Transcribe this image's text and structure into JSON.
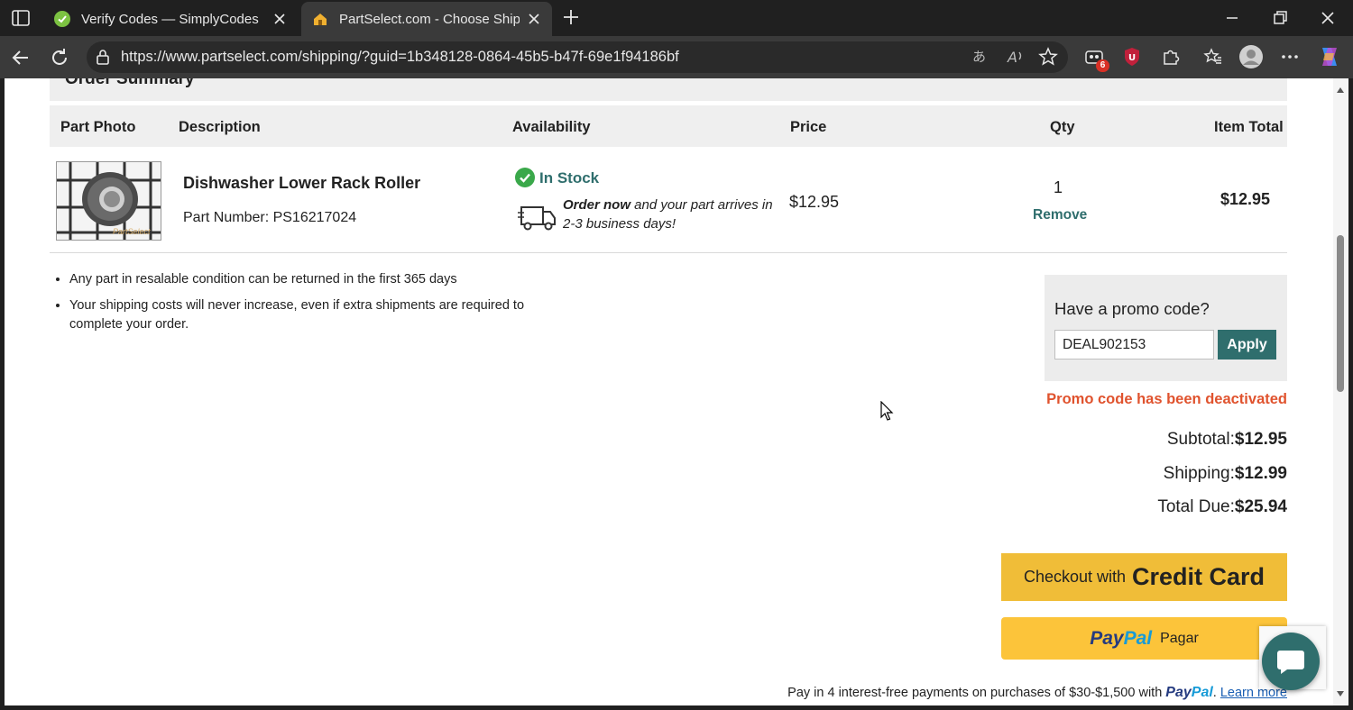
{
  "browser": {
    "tabs": [
      {
        "title": "Verify Codes — SimplyCodes",
        "active": false
      },
      {
        "title": "PartSelect.com - Choose Shipping",
        "active": true
      }
    ],
    "url": "https://www.partselect.com/shipping/?guid=1b348128-0864-45b5-b47f-69e1f94186bf",
    "extension_badge": "6"
  },
  "page": {
    "section_title": "Order Summary",
    "columns": [
      "Part Photo",
      "Description",
      "Availability",
      "Price",
      "Qty",
      "Item Total"
    ],
    "item": {
      "name": "Dishwasher Lower Rack Roller",
      "part_number": "Part Number: PS16217024",
      "availability": "In Stock",
      "ship_lead": "Order now",
      "ship_rest": " and your part arrives in 2-3 business days!",
      "price": "$12.95",
      "qty": "1",
      "remove_label": "Remove",
      "item_total": "$12.95",
      "photo_watermark": "PartSelect"
    },
    "notes": [
      "Any part in resalable condition can be returned in the first 365 days",
      "Your shipping costs will never increase, even if extra shipments are required to complete your order."
    ],
    "promo": {
      "title": "Have a promo code?",
      "value": "DEAL902153",
      "apply_label": "Apply",
      "error": "Promo code has been deactivated"
    },
    "totals": {
      "subtotal_label": "Subtotal:",
      "subtotal": "$12.95",
      "shipping_label": "Shipping:",
      "shipping": "$12.99",
      "total_label": "Total Due:",
      "total": "$25.94"
    },
    "checkout": {
      "cc_small": "Checkout with",
      "cc_big": "Credit Card",
      "paypal_p1": "Pay",
      "paypal_p2": "Pal",
      "paypal_action": "Pagar",
      "paylater_text": "Pay in 4 interest-free payments on purchases of $30-$1,500 with ",
      "paylater_suffix": ". ",
      "learn_more": "Learn more"
    }
  },
  "colors": {
    "accent_teal": "#2f6e6d",
    "error_orange": "#e0532e",
    "cc_button": "#f0bd38",
    "paypal_button": "#fcc43a"
  }
}
